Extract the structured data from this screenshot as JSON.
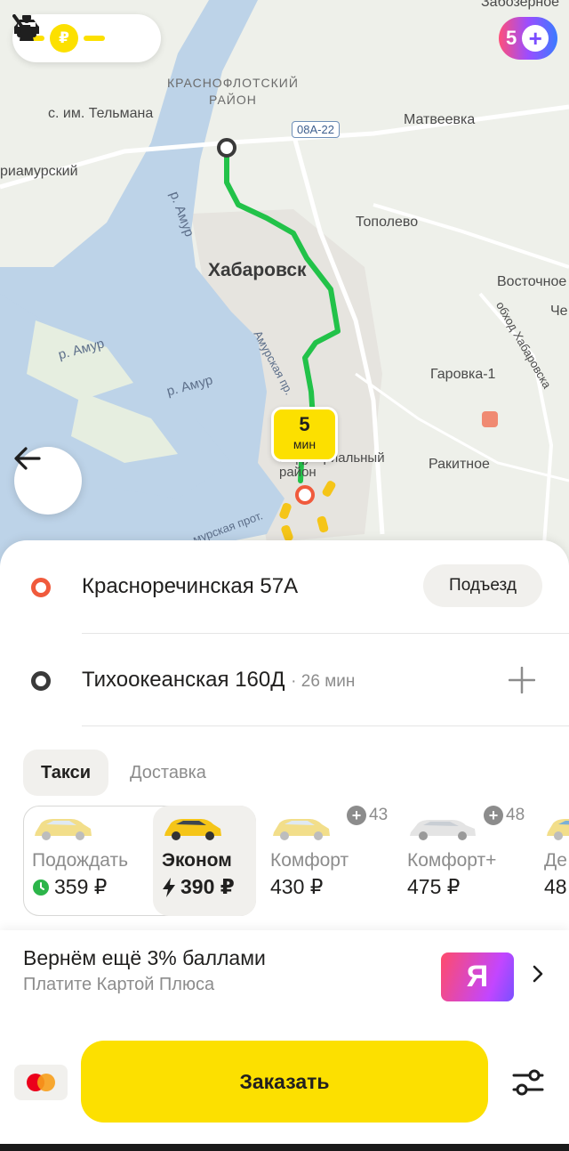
{
  "map": {
    "labels": {
      "zabozernoe": "Забозерное",
      "district": "КРАСНОФЛОТСКИЙ\nРАЙОН",
      "telmana": "с. им. Тельмана",
      "matveevka": "Матвеевка",
      "priamursky": "риамурский",
      "topolevo": "Тополево",
      "khabarovsk": "Хабаровск",
      "vostochnoe": "Восточное",
      "che": "Че",
      "garovka": "Гаровка-1",
      "rakitnoe": "Ракитное",
      "industrial": "Индустриальный\nрайон",
      "river_amur_1": "р. Амур",
      "river_amur_2": "р. Амур",
      "river_amur_3": "р. Амур",
      "amurskaya": "Амурская пр.",
      "amurskaya_2": "мурская прот.",
      "bypass": "обход Хабаровска"
    },
    "road_badge": "08А-22",
    "eta": {
      "value": "5",
      "unit": "мин"
    },
    "plus_points": "5",
    "route_color": "#22c249"
  },
  "trip": {
    "from": "Красноречинская 57А",
    "entrance_label": "Подъезд",
    "to": "Тихоокеанская 160Д",
    "to_duration": "· 26 мин"
  },
  "tabs": [
    {
      "label": "Такси",
      "active": true
    },
    {
      "label": "Доставка",
      "active": false
    }
  ],
  "tariffs": [
    {
      "name": "Подождать",
      "price": "359 ₽",
      "icon": "clock-icon"
    },
    {
      "name": "Эконом",
      "price": "390 ₽",
      "icon": "lightning-icon",
      "selected": true
    },
    {
      "name": "Комфорт",
      "price": "430 ₽"
    },
    {
      "name": "Комфорт+",
      "price": "475 ₽"
    },
    {
      "name": "Де",
      "price": "48"
    }
  ],
  "plus_badges": {
    "comfort": "43",
    "comfort_plus": "48"
  },
  "cashback": {
    "title": "Вернём ещё 3% баллами",
    "subtitle": "Платите Картой Плюса",
    "card_letter": "Я"
  },
  "order_button": "Заказать",
  "colors": {
    "accent": "#fce000",
    "origin": "#f05a3c"
  }
}
